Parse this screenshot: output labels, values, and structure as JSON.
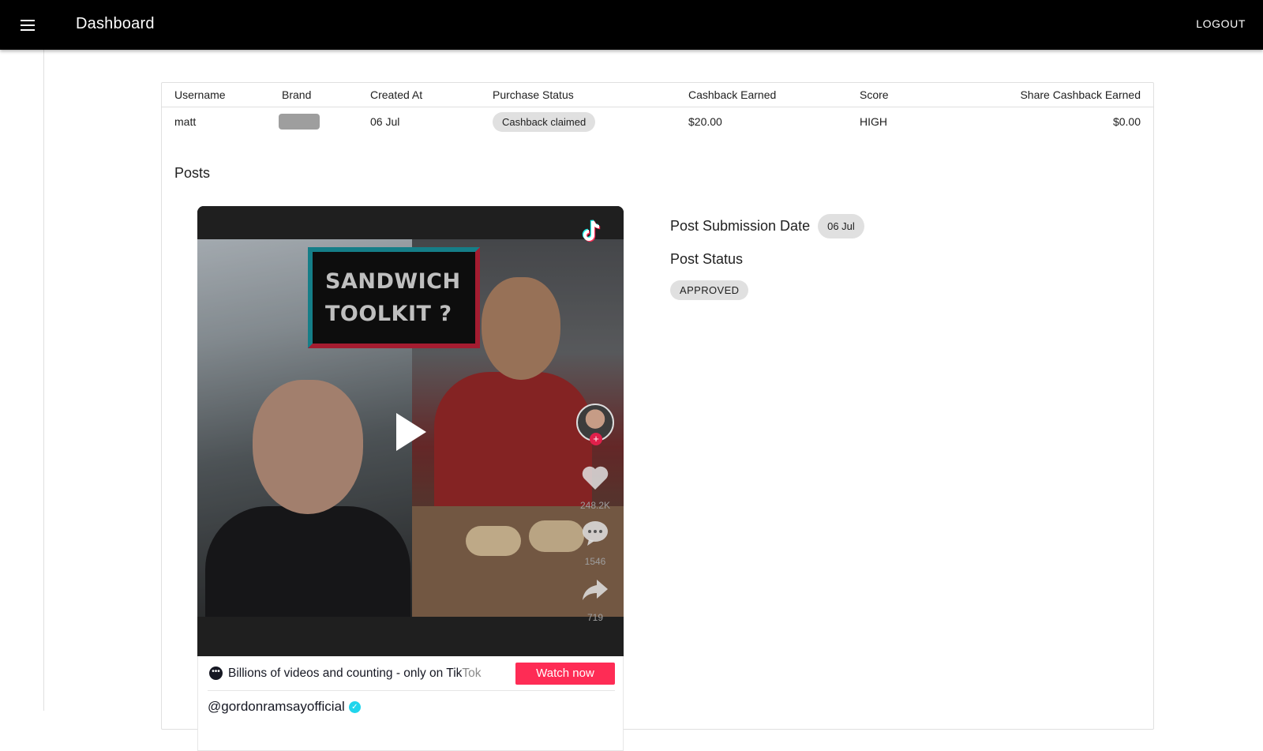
{
  "appbar": {
    "title": "Dashboard",
    "logout_label": "LOGOUT"
  },
  "table": {
    "headers": {
      "username": "Username",
      "brand": "Brand",
      "created_at": "Created At",
      "purchase_status": "Purchase Status",
      "cashback_earned": "Cashback Earned",
      "score": "Score",
      "share_cashback_earned": "Share Cashback Earned"
    },
    "row": {
      "username": "matt",
      "created_at": "06 Jul",
      "purchase_status": "Cashback claimed",
      "cashback_earned": "$20.00",
      "score": "HIGH",
      "share_cashback_earned": "$0.00"
    }
  },
  "posts": {
    "title": "Posts",
    "video": {
      "overlay_line1": "SANDWICH",
      "overlay_line2": "TOOLKIT ?",
      "likes": "248.2K",
      "comments": "1546",
      "shares": "719"
    },
    "banner": {
      "text": "Billions of videos and counting - only on Tik",
      "text_fade": "Tok",
      "watch_label": "Watch now",
      "handle": "@gordonramsayofficial"
    },
    "details": {
      "submission_label": "Post Submission Date",
      "submission_date": "06 Jul",
      "status_label": "Post Status",
      "status_value": "APPROVED"
    }
  },
  "colors": {
    "appbar": "#000000",
    "tiktok_red": "#fe2c55",
    "chip": "#e0e0e0",
    "verified": "#20d5ec"
  }
}
